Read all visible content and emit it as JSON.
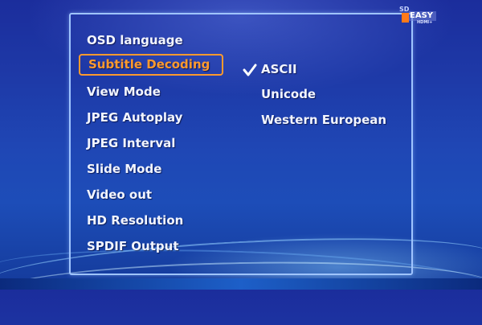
{
  "logo": {
    "top_text": "SD",
    "main_text": "EASY",
    "sub_text": "HDMI+"
  },
  "menu": {
    "items": [
      {
        "label": "OSD language",
        "selected": false
      },
      {
        "label": "Subtitle Decoding",
        "selected": true
      },
      {
        "label": "View Mode",
        "selected": false
      },
      {
        "label": "JPEG Autoplay",
        "selected": false
      },
      {
        "label": "JPEG Interval",
        "selected": false
      },
      {
        "label": "Slide Mode",
        "selected": false
      },
      {
        "label": "Video out",
        "selected": false
      },
      {
        "label": "HD Resolution",
        "selected": false
      },
      {
        "label": "SPDIF Output",
        "selected": false
      }
    ]
  },
  "submenu": {
    "options": [
      {
        "label": "ASCII",
        "checked": true
      },
      {
        "label": "Unicode",
        "checked": false
      },
      {
        "label": "Western European",
        "checked": false
      }
    ]
  },
  "colors": {
    "selected": "#ff9a2e",
    "text": "#f2f5ff",
    "border": "#9fc4ff"
  },
  "icons": {
    "check": "check-icon",
    "logo": "easy-hdmi-logo"
  }
}
